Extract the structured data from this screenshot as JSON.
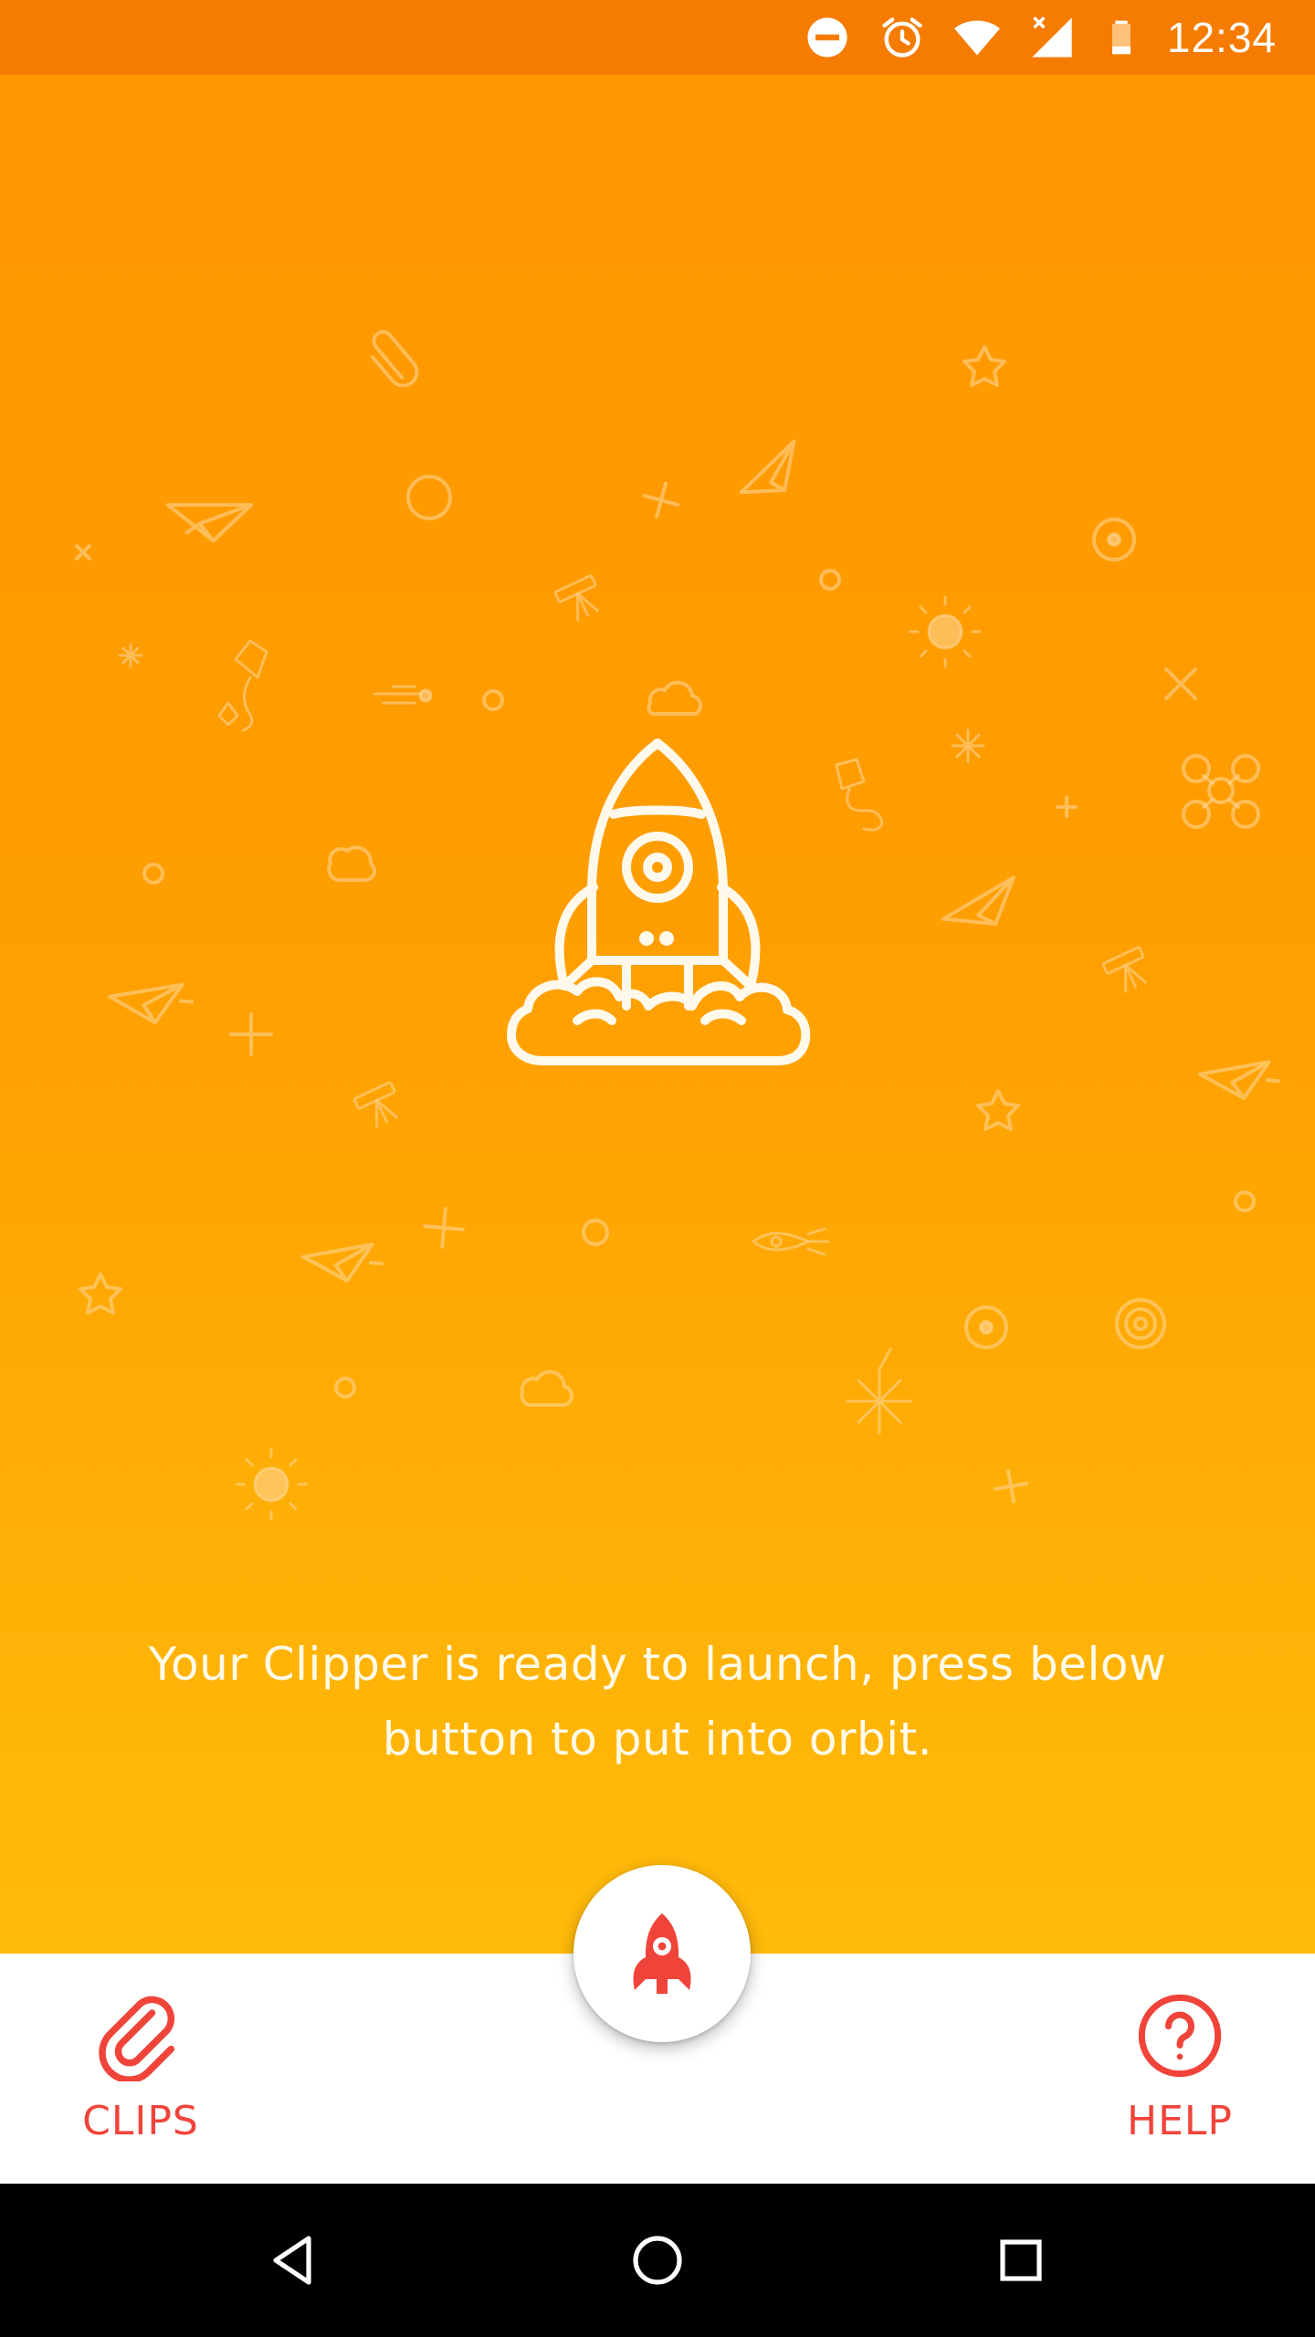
{
  "status_bar": {
    "time": "12:34",
    "icons": [
      "do-not-disturb-icon",
      "alarm-icon",
      "wifi-icon",
      "cell-signal-icon",
      "battery-icon"
    ]
  },
  "main": {
    "illustration": "rocket-launch-icon",
    "message": "Your Clipper is ready to launch, press below button to put into orbit."
  },
  "bottom_nav": {
    "clips_label": "CLIPS",
    "help_label": "HELP",
    "fab_icon": "rocket-icon"
  },
  "colors": {
    "status_bar": "#f57c00",
    "background_top": "#ff9700",
    "background_bottom": "#ffbb0a",
    "accent": "#f0443a",
    "fab": "#ffffff"
  }
}
